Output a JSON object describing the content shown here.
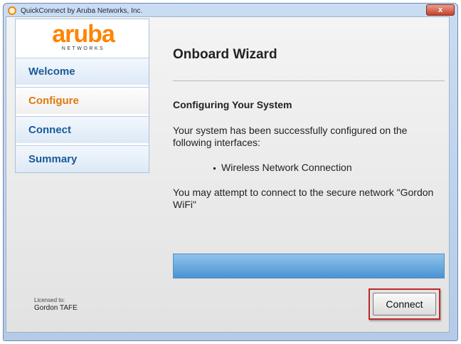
{
  "window": {
    "title": "QuickConnect by Aruba Networks, Inc.",
    "close_glyph": "x"
  },
  "logo": {
    "word": "aruba",
    "sub": "NETWORKS",
    "color": "#ff8300"
  },
  "nav": {
    "items": [
      {
        "label": "Welcome",
        "active": false
      },
      {
        "label": "Configure",
        "active": true
      },
      {
        "label": "Connect",
        "active": false
      },
      {
        "label": "Summary",
        "active": false
      }
    ]
  },
  "content": {
    "title": "Onboard Wizard",
    "heading": "Configuring Your System",
    "message": "Your system has been successfully configured on the following interfaces:",
    "interfaces": [
      "Wireless Network Connection"
    ],
    "attempt_message": "You may attempt to connect to the secure network \"Gordon WiFi\""
  },
  "progress": {
    "fraction": 1.0
  },
  "license": {
    "label": "Licensed to:",
    "value": "Gordon TAFE"
  },
  "buttons": {
    "connect_label": "Connect"
  },
  "colors": {
    "accent_orange": "#e2780c",
    "nav_blue": "#1a5a9a",
    "highlight_red": "#c0282d"
  }
}
